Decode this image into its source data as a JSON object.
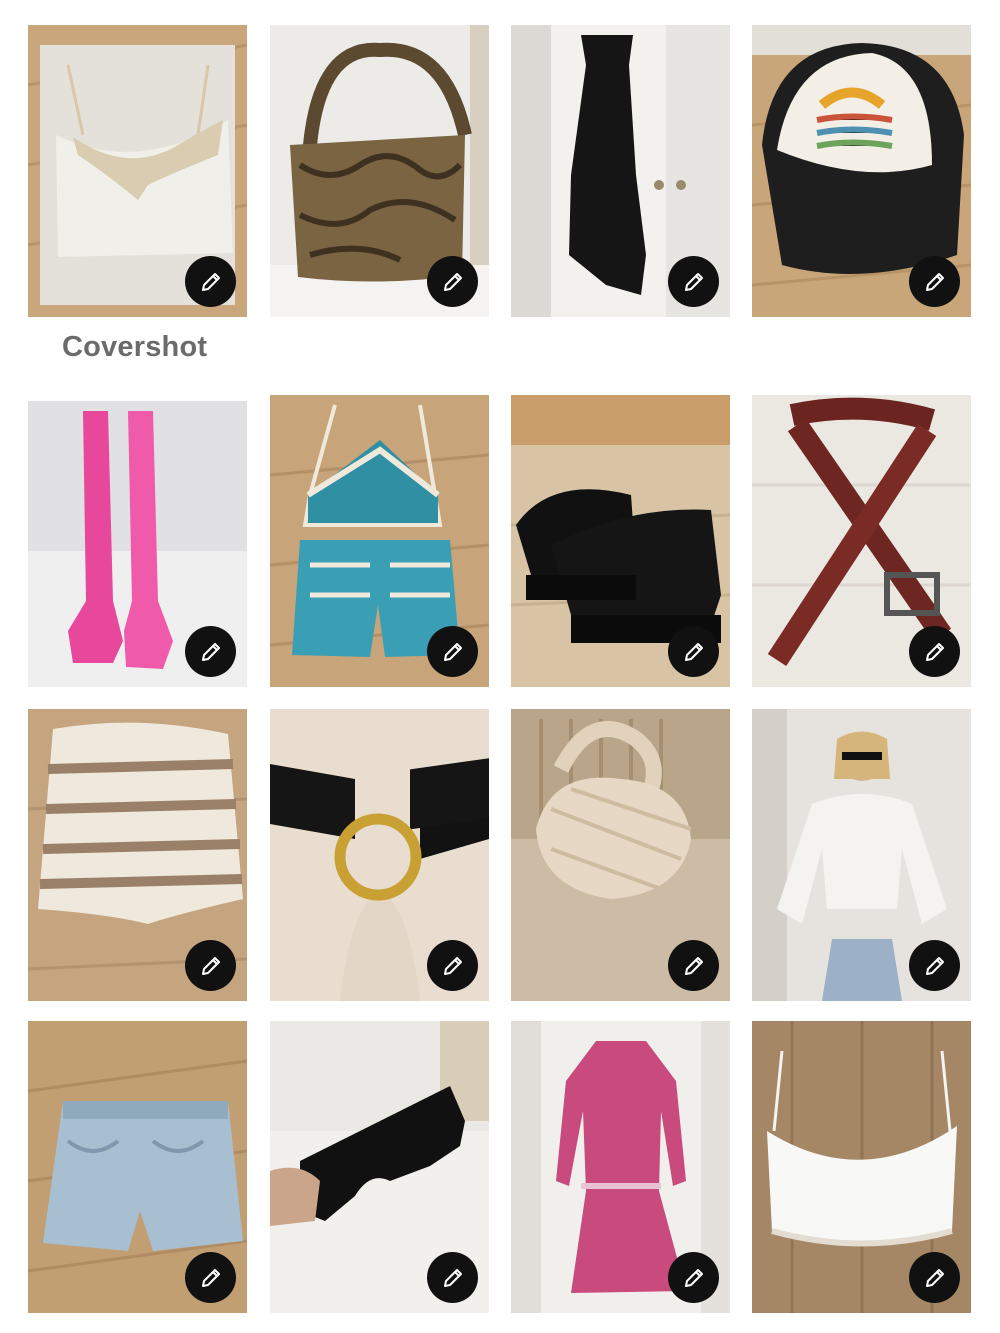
{
  "caption": "Covershot",
  "edit_icon": "pencil-icon",
  "listings": [
    {
      "name": "lace-satin-camisole",
      "icon": "pencil-icon"
    },
    {
      "name": "snakeskin-shoulder-bag",
      "icon": "pencil-icon"
    },
    {
      "name": "black-slip-dress",
      "icon": "pencil-icon"
    },
    {
      "name": "trucker-hat",
      "icon": "pencil-icon"
    },
    {
      "name": "pink-cowboy-boots",
      "icon": "pencil-icon"
    },
    {
      "name": "crochet-top-shorts-set",
      "icon": "pencil-icon"
    },
    {
      "name": "black-platform-sandals",
      "icon": "pencil-icon"
    },
    {
      "name": "brown-studded-belt",
      "icon": "pencil-icon"
    },
    {
      "name": "knit-striped-shorts",
      "icon": "pencil-icon"
    },
    {
      "name": "black-ring-belt",
      "icon": "pencil-icon"
    },
    {
      "name": "woven-knot-handbag",
      "icon": "pencil-icon"
    },
    {
      "name": "white-eyelet-tie-top",
      "icon": "pencil-icon"
    },
    {
      "name": "denim-shorts",
      "icon": "pencil-icon"
    },
    {
      "name": "black-sunglasses",
      "icon": "pencil-icon"
    },
    {
      "name": "pink-print-dress",
      "icon": "pencil-icon"
    },
    {
      "name": "white-lace-bralette",
      "icon": "pencil-icon"
    }
  ],
  "colors": {
    "edit_button": "#111111",
    "caption": "#6b6b6b"
  }
}
